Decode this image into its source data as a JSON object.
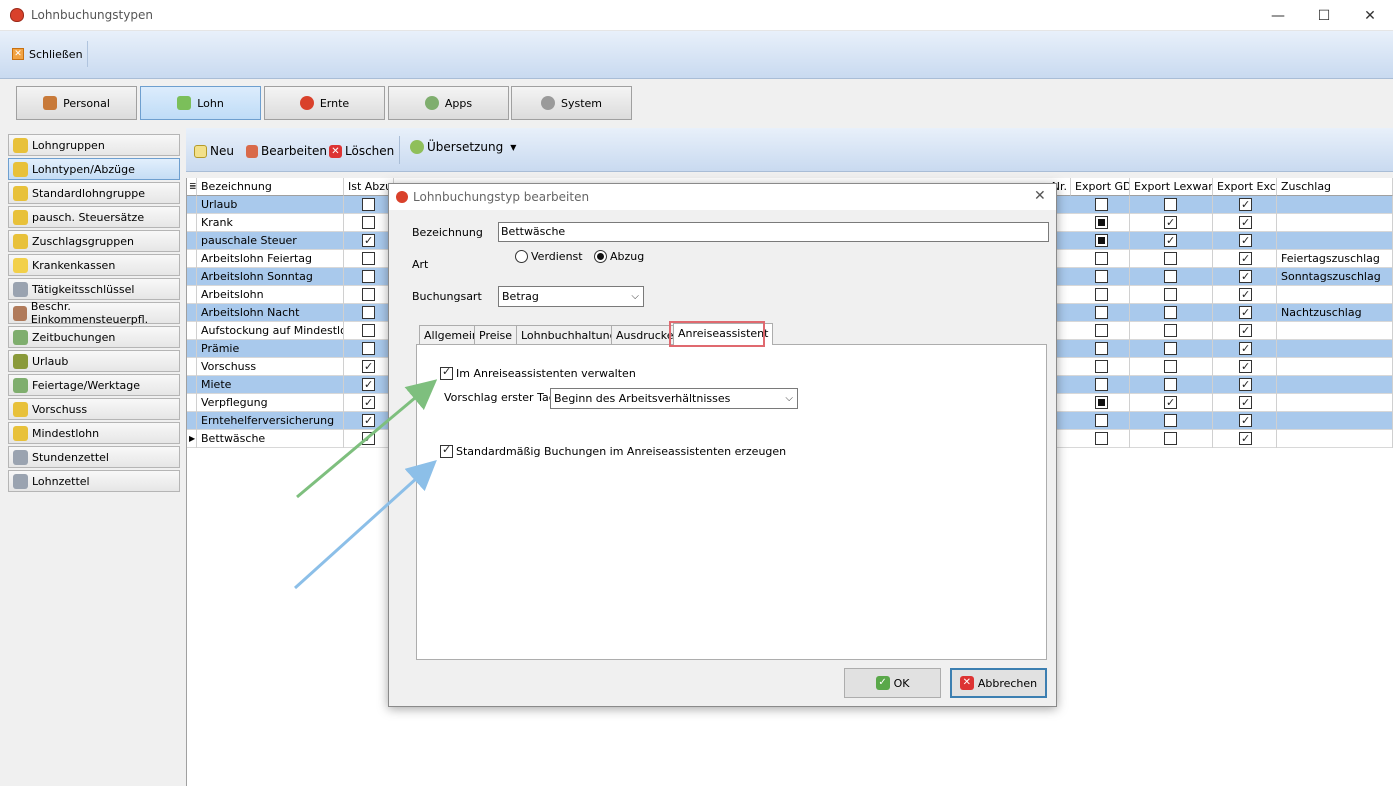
{
  "window": {
    "title": "Lohnbuchungstypen",
    "minimize": "—",
    "maximize": "☐",
    "close": "✕"
  },
  "cmdbar": {
    "close_label": "Schließen"
  },
  "modules": [
    {
      "label": "Personal"
    },
    {
      "label": "Lohn"
    },
    {
      "label": "Ernte"
    },
    {
      "label": "Apps"
    },
    {
      "label": "System"
    }
  ],
  "sidebar": {
    "items": [
      {
        "label": "Lohngruppen"
      },
      {
        "label": "Lohntypen/Abzüge"
      },
      {
        "label": "Standardlohngruppe"
      },
      {
        "label": "pausch. Steuersätze"
      },
      {
        "label": "Zuschlagsgruppen"
      },
      {
        "label": "Krankenkassen"
      },
      {
        "label": "Tätigkeitsschlüssel"
      },
      {
        "label": "Beschr. Einkommensteuerpfl."
      },
      {
        "label": "Zeitbuchungen"
      },
      {
        "label": "Urlaub"
      },
      {
        "label": "Feiertage/Werktage"
      },
      {
        "label": "Vorschuss"
      },
      {
        "label": "Mindestlohn"
      },
      {
        "label": "Stundenzettel"
      },
      {
        "label": "Lohnzettel"
      }
    ]
  },
  "toolbar": {
    "new_label": "Neu",
    "edit_label": "Bearbeiten",
    "delete_label": "Löschen",
    "translation_label": "Übersetzung"
  },
  "grid": {
    "columns": {
      "bezeichnung": "Bezeichnung",
      "ist_abzug": "Ist Abzug",
      "nr": "Nr.",
      "export_gdi": "Export GDI",
      "export_lexware": "Export Lexware",
      "export_excel": "Export Excel",
      "zuschlag": "Zuschlag"
    },
    "rows": [
      {
        "name": "Urlaub",
        "abzug": false,
        "gdi": "off",
        "lex": false,
        "excel": true,
        "zuschlag": ""
      },
      {
        "name": "Krank",
        "abzug": false,
        "gdi": "ind",
        "lex": true,
        "excel": true,
        "zuschlag": ""
      },
      {
        "name": "pauschale Steuer",
        "abzug": true,
        "gdi": "ind",
        "lex": true,
        "excel": true,
        "zuschlag": ""
      },
      {
        "name": "Arbeitslohn Feiertag",
        "abzug": false,
        "gdi": "off",
        "lex": false,
        "excel": true,
        "zuschlag": "Feiertagszuschlag"
      },
      {
        "name": "Arbeitslohn Sonntag",
        "abzug": false,
        "gdi": "off",
        "lex": false,
        "excel": true,
        "zuschlag": "Sonntagszuschlag"
      },
      {
        "name": "Arbeitslohn",
        "abzug": false,
        "gdi": "off",
        "lex": false,
        "excel": true,
        "zuschlag": ""
      },
      {
        "name": "Arbeitslohn Nacht",
        "abzug": false,
        "gdi": "off",
        "lex": false,
        "excel": true,
        "zuschlag": "Nachtzuschlag"
      },
      {
        "name": "Aufstockung auf Mindestlohn",
        "abzug": false,
        "gdi": "off",
        "lex": false,
        "excel": true,
        "zuschlag": ""
      },
      {
        "name": "Prämie",
        "abzug": false,
        "gdi": "off",
        "lex": false,
        "excel": true,
        "zuschlag": ""
      },
      {
        "name": "Vorschuss",
        "abzug": true,
        "gdi": "off",
        "lex": false,
        "excel": true,
        "zuschlag": ""
      },
      {
        "name": "Miete",
        "abzug": true,
        "gdi": "off",
        "lex": false,
        "excel": true,
        "zuschlag": ""
      },
      {
        "name": "Verpflegung",
        "abzug": true,
        "gdi": "ind",
        "lex": true,
        "excel": true,
        "zuschlag": ""
      },
      {
        "name": "Erntehelferversicherung",
        "abzug": true,
        "gdi": "off",
        "lex": false,
        "excel": true,
        "zuschlag": ""
      },
      {
        "name": "Bettwäsche",
        "abzug": true,
        "gdi": "off",
        "lex": false,
        "excel": true,
        "zuschlag": ""
      }
    ]
  },
  "dialog": {
    "title": "Lohnbuchungstyp bearbeiten",
    "bezeichnung_label": "Bezeichnung",
    "bezeichnung_value": "Bettwäsche",
    "art_label": "Art",
    "art_verdienst": "Verdienst",
    "art_abzug": "Abzug",
    "buchungsart_label": "Buchungsart",
    "buchungsart_value": "Betrag",
    "tabs": [
      "Allgemein",
      "Preise",
      "Lohnbuchhaltung",
      "Ausdrucke",
      "Anreiseassistent"
    ],
    "active_tab": "Anreiseassistent",
    "im_assistent_label": "Im Anreiseassistenten verwalten",
    "vorschlag_label": "Vorschlag erster Tag",
    "vorschlag_value": "Beginn des Arbeitsverhältnisses",
    "standard_label": "Standardmäßig Buchungen im Anreiseassistenten erzeugen",
    "ok_label": "OK",
    "cancel_label": "Abbrechen"
  },
  "colors": {
    "highlight_box": "#e0696f",
    "arrow_green": "#7ebf7e",
    "arrow_blue": "#8cbfe8",
    "row_alt": "#a9c9ec"
  }
}
